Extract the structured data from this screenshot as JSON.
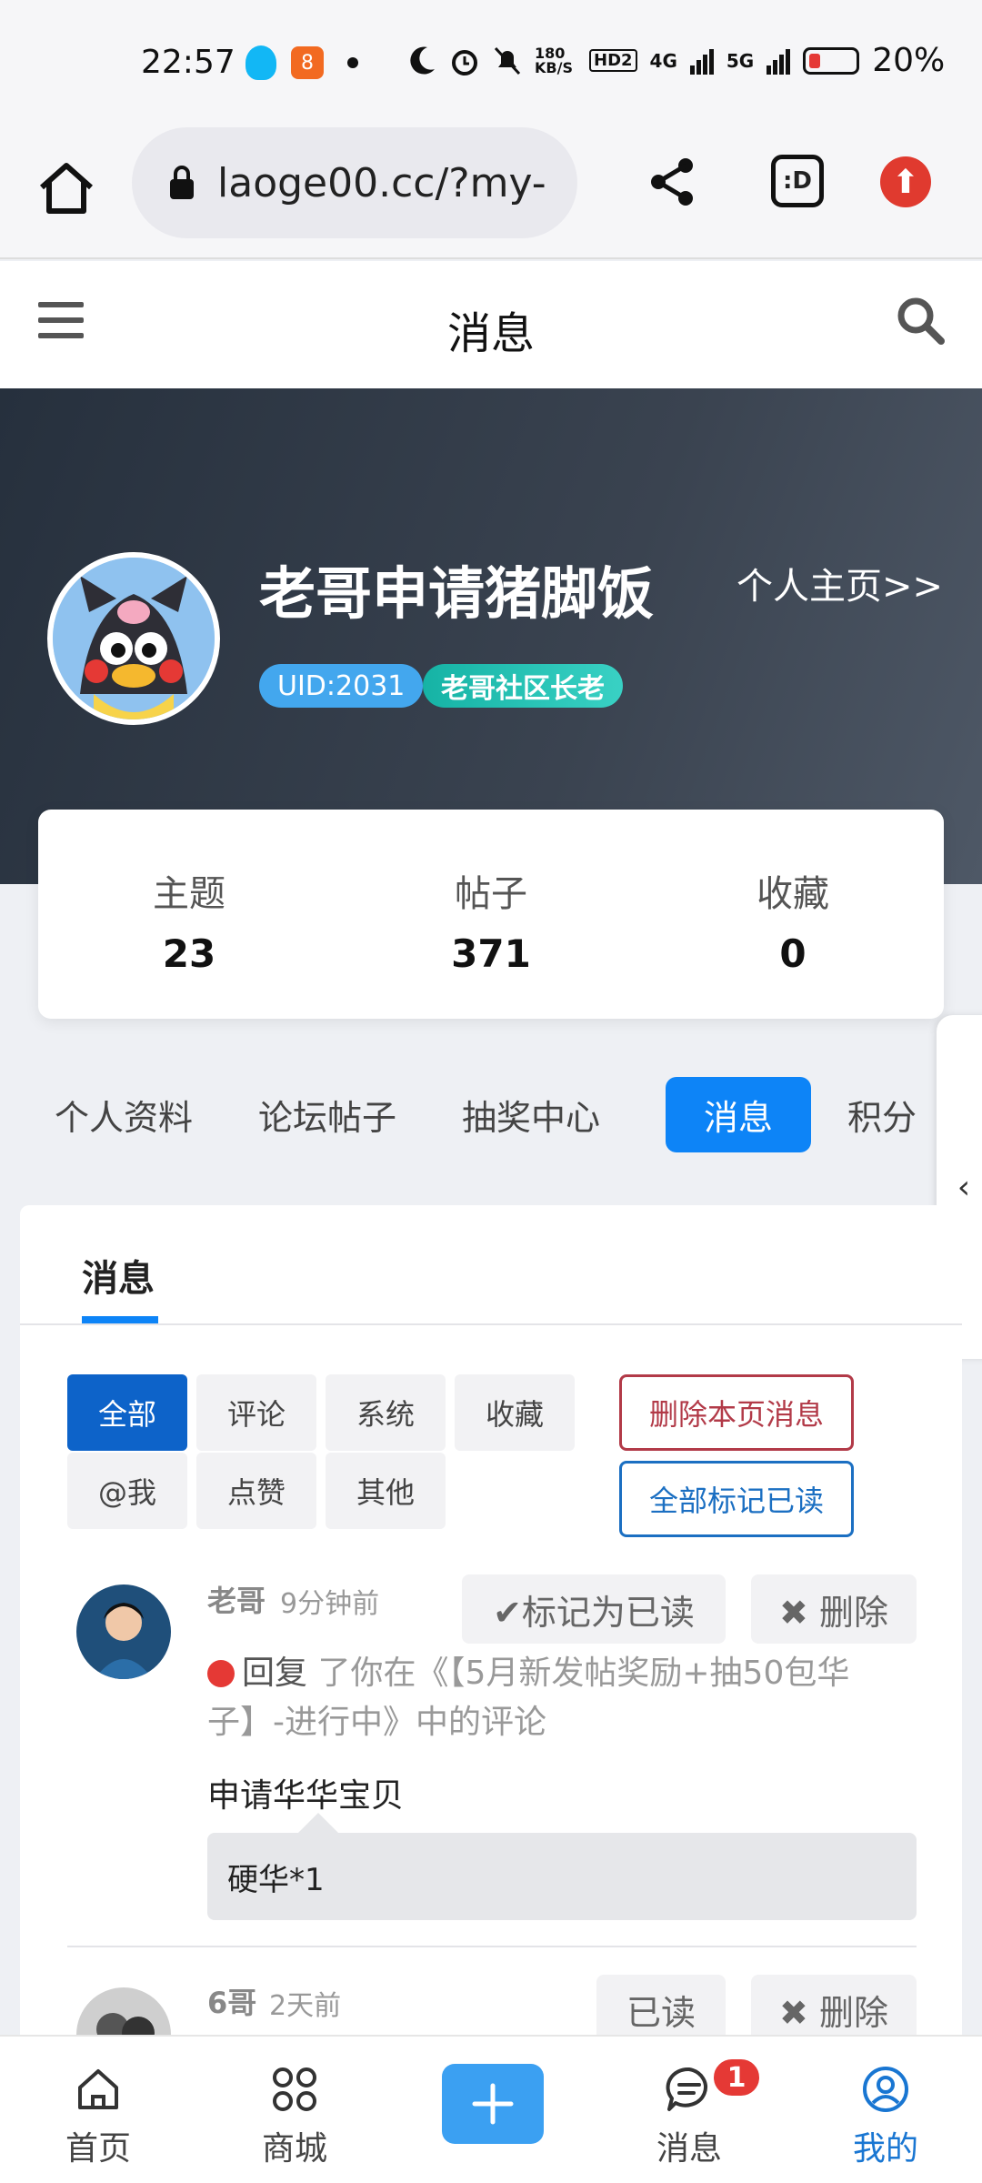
{
  "status_bar": {
    "time": "22:57",
    "app_icon_2": "8",
    "net_speed": "180 KB/S",
    "hd": "HD2",
    "signal_1": "4G",
    "signal_2": "5G",
    "battery": "20%"
  },
  "browser": {
    "url": "laoge00.cc/?my-",
    "tab_label": ":D",
    "icons": [
      "home-icon",
      "lock-icon",
      "share-icon",
      "tab-switcher-icon",
      "update-icon"
    ]
  },
  "header": {
    "title": "消息"
  },
  "profile": {
    "name": "老哥申请猪脚饭",
    "homepage_link": "个人主页>>",
    "uid_badge": "UID:2031",
    "rank_badge": "老哥社区长老"
  },
  "stats": [
    {
      "label": "主题",
      "value": "23"
    },
    {
      "label": "帖子",
      "value": "371"
    },
    {
      "label": "收藏",
      "value": "0"
    }
  ],
  "tabs": [
    "个人资料",
    "论坛帖子",
    "抽奖中心",
    "消息",
    "积分"
  ],
  "active_tab": "消息",
  "panel": {
    "tab_label": "消息",
    "filters": [
      "全部",
      "评论",
      "系统",
      "收藏",
      "@我",
      "点赞",
      "其他"
    ],
    "delete_page_label": "删除本页消息",
    "mark_all_read_label": "全部标记已读"
  },
  "messages": [
    {
      "sender": "老哥",
      "time": "9分钟前",
      "mark_read_label": "✔标记为已读",
      "delete_label": "✖ 删除",
      "action_prefix": "回复",
      "action_text": "了你在《【5月新发帖奖励+抽50包华子】-进行中》中的评论",
      "content": "申请华华宝贝",
      "quote": "硬华*1"
    },
    {
      "sender": "6哥",
      "time": "2天前",
      "read_label": "已读",
      "delete_label": "✖ 删除"
    }
  ],
  "bottom_nav": [
    {
      "label": "首页",
      "icon": "home-icon"
    },
    {
      "label": "商城",
      "icon": "grid-icon"
    },
    {
      "label": "",
      "icon": "plus-icon"
    },
    {
      "label": "消息",
      "icon": "chat-icon",
      "badge": "1"
    },
    {
      "label": "我的",
      "icon": "user-icon"
    }
  ],
  "colors": {
    "primary": "#0d84f7",
    "hero_dark": "#26303d",
    "danger": "#e53935"
  }
}
